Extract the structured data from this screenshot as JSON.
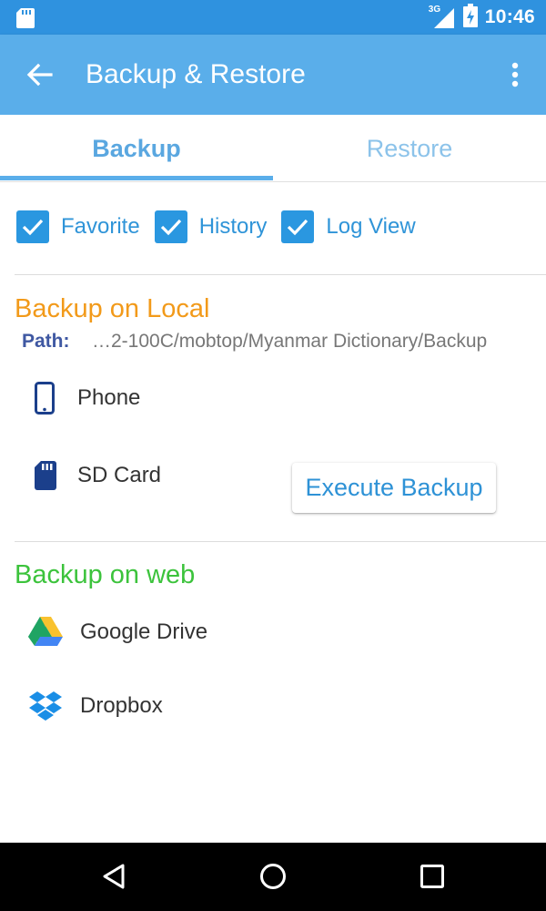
{
  "status_bar": {
    "network_type": "3G",
    "time": "10:46",
    "icons": [
      "sd-card-icon",
      "signal-icon",
      "battery-charging-icon"
    ]
  },
  "app_bar": {
    "title": "Backup & Restore",
    "back_icon": "arrow-back-icon",
    "menu_icon": "more-vert-icon",
    "color": "#5aaeea"
  },
  "tabs": [
    {
      "label": "Backup",
      "active": true
    },
    {
      "label": "Restore",
      "active": false
    }
  ],
  "options": [
    {
      "label": "Favorite",
      "checked": true
    },
    {
      "label": "History",
      "checked": true
    },
    {
      "label": "Log View",
      "checked": true
    }
  ],
  "local": {
    "title": "Backup on Local",
    "title_color": "#f29a1a",
    "path_label": "Path:",
    "path_value": "…2-100C/mobtop/Myanmar Dictionary/Backup",
    "storage": [
      {
        "label": "Phone",
        "icon": "phone-icon"
      },
      {
        "label": "SD Card",
        "icon": "sd-card-icon"
      }
    ],
    "execute_label": "Execute Backup"
  },
  "web": {
    "title": "Backup on web",
    "title_color": "#3cc33c",
    "services": [
      {
        "label": "Google Drive",
        "icon": "google-drive-icon"
      },
      {
        "label": "Dropbox",
        "icon": "dropbox-icon"
      }
    ]
  },
  "nav_bar": {
    "buttons": [
      "back-nav-icon",
      "home-nav-icon",
      "recents-nav-icon"
    ]
  }
}
